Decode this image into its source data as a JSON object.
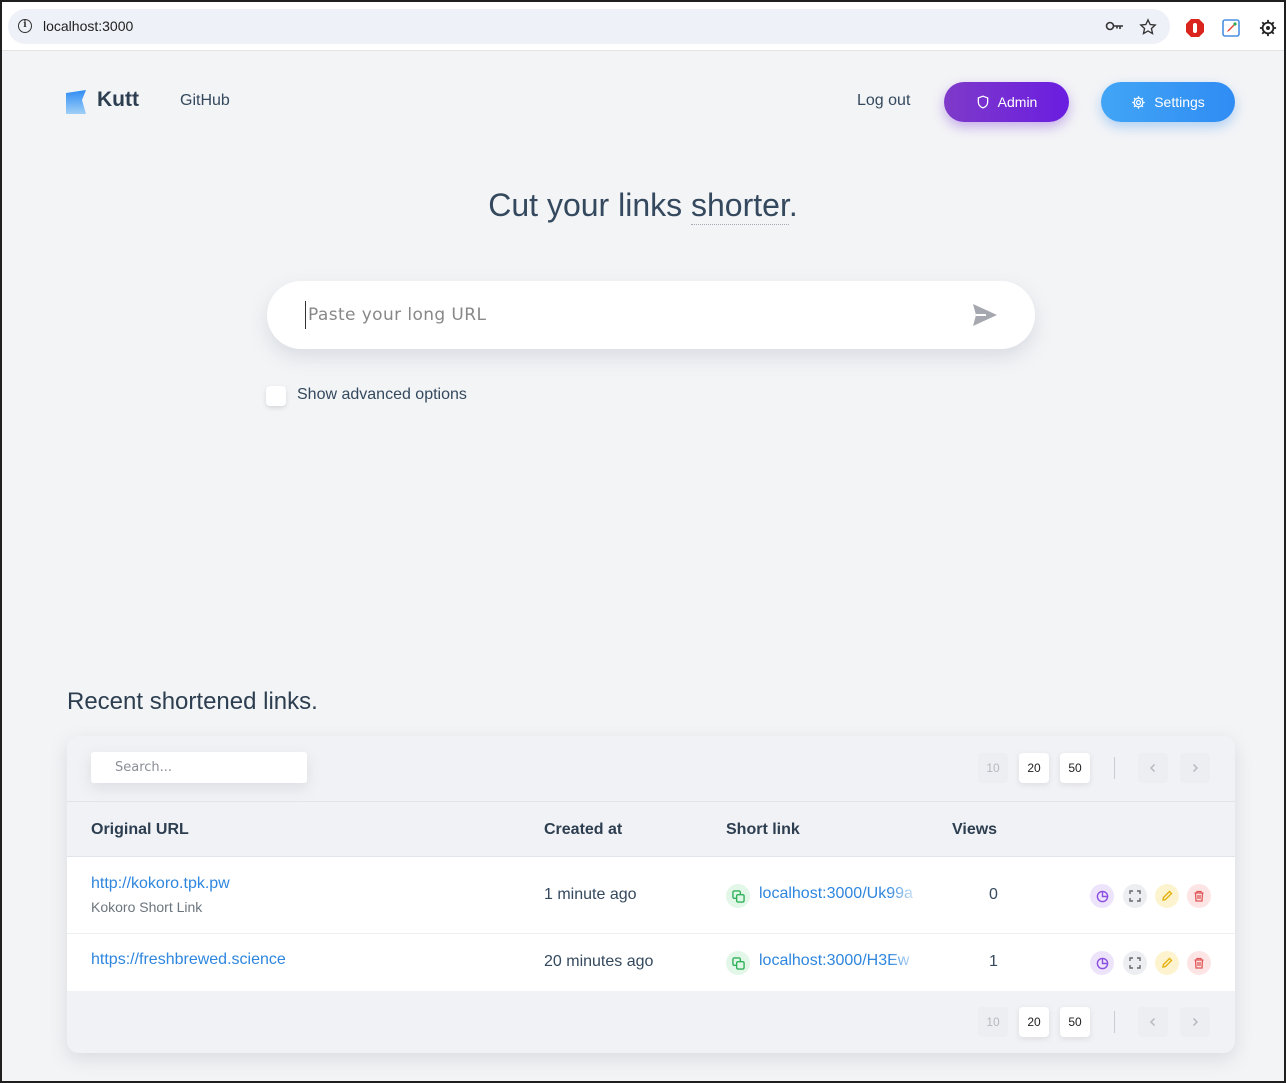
{
  "browser": {
    "url": "localhost:3000",
    "info_icon": "i"
  },
  "header": {
    "logo_text": "Kutt",
    "nav_github": "GitHub",
    "logout": "Log out",
    "admin_label": "Admin",
    "settings_label": "Settings"
  },
  "hero": {
    "title_main": "Cut your links ",
    "title_accent": "shorter",
    "title_end": "."
  },
  "shortener": {
    "placeholder": "Paste your long URL",
    "value": "",
    "advanced_label": "Show advanced options",
    "advanced_checked": false
  },
  "recent": {
    "title": "Recent shortened links.",
    "search_placeholder": "Search...",
    "page_sizes": [
      "10",
      "20",
      "50"
    ],
    "columns": {
      "original": "Original URL",
      "created": "Created at",
      "short": "Short link",
      "views": "Views"
    },
    "rows": [
      {
        "original_url": "http://kokoro.tpk.pw",
        "description": "Kokoro Short Link",
        "created": "1 minute ago",
        "short_link": "localhost:3000/Uk99a",
        "views": "0"
      },
      {
        "original_url": "https://freshbrewed.science",
        "description": "",
        "created": "20 minutes ago",
        "short_link": "localhost:3000/H3Ew",
        "views": "1"
      }
    ]
  },
  "colors": {
    "admin_gradient": [
      "#7e3ac9",
      "#6a1de0"
    ],
    "settings_gradient": [
      "#42a5f5",
      "#2f8cf4"
    ],
    "link": "#2e86de",
    "text": "#2c3e50"
  },
  "icons": [
    "info-icon",
    "key-icon",
    "star-icon",
    "stop-extension-icon",
    "edit-extension-icon",
    "puzzle-icon",
    "kutt-logo",
    "shield-icon",
    "gear-icon",
    "send-icon",
    "copy-icon",
    "chart-icon",
    "qrcode-icon",
    "pencil-icon",
    "trash-icon",
    "chevron-left-icon",
    "chevron-right-icon"
  ]
}
